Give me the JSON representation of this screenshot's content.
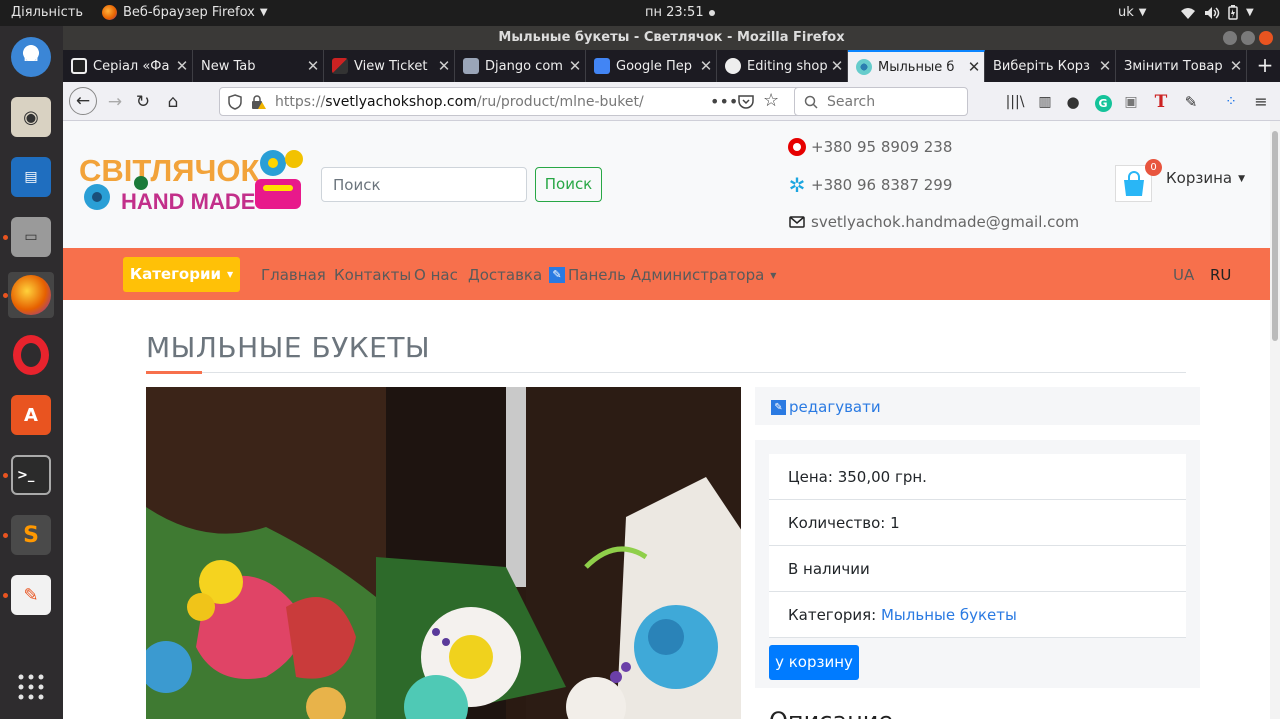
{
  "system_bar": {
    "activities": "Діяльність",
    "app_name": "Веб-браузер Firefox",
    "clock": "пн 23:51",
    "keyboard_layout": "uk"
  },
  "dock": {
    "items": [
      "thunderbird",
      "rhythmbox",
      "libreoffice-writer",
      "files",
      "firefox",
      "opera",
      "software-center",
      "terminal",
      "sublime-text",
      "text-editor",
      "show-apps"
    ]
  },
  "window": {
    "title": "Мыльные букеты - Светлячок - Mozilla Firefox"
  },
  "tabs": [
    {
      "label": "Серіал «Фа"
    },
    {
      "label": "New Tab"
    },
    {
      "label": "View Ticket"
    },
    {
      "label": "Django com"
    },
    {
      "label": "Google Пер"
    },
    {
      "label": "Editing shop"
    },
    {
      "label": "Мыльные б"
    },
    {
      "label": "Виберіть Корз"
    },
    {
      "label": "Змінити Товар"
    }
  ],
  "address": {
    "prefix": "https://",
    "domain": "svetlyachokshop.com",
    "path": "/ru/product/mlne-buket/",
    "search_placeholder": "Search"
  },
  "site": {
    "logo_line1": "СВІТЛЯЧОК",
    "logo_line2": "HAND MADE",
    "search_placeholder": "Поиск",
    "search_button": "Поиск",
    "phone1": "+380 95 8909 238",
    "phone2": "+380 96 8387 299",
    "email": "svetlyachok.handmade@gmail.com",
    "cart_count": "0",
    "cart_label": "Корзина"
  },
  "menu": {
    "categories": "Категории",
    "home": "Главная",
    "contacts": "Контакты",
    "about": "О нас",
    "delivery": "Доставка",
    "admin": "Панель Администратора",
    "lang_ua": "UA",
    "lang_ru": "RU"
  },
  "product": {
    "title": "МЫЛЬНЫЕ БУКЕТЫ",
    "edit_link": "редагувати",
    "price": "Цена: 350,00 грн.",
    "quantity": "Количество: 1",
    "availability": "В наличии",
    "category_label": "Категория: ",
    "category_value": "Мыльные букеты",
    "add_to_cart": "у корзину",
    "description_heading": "Описание"
  },
  "colors": {
    "accent_orange": "#f7704c",
    "category_yellow": "#ffc107",
    "primary_blue": "#007bff",
    "success_green": "#28a745",
    "ubuntu_orange": "#e95420"
  }
}
